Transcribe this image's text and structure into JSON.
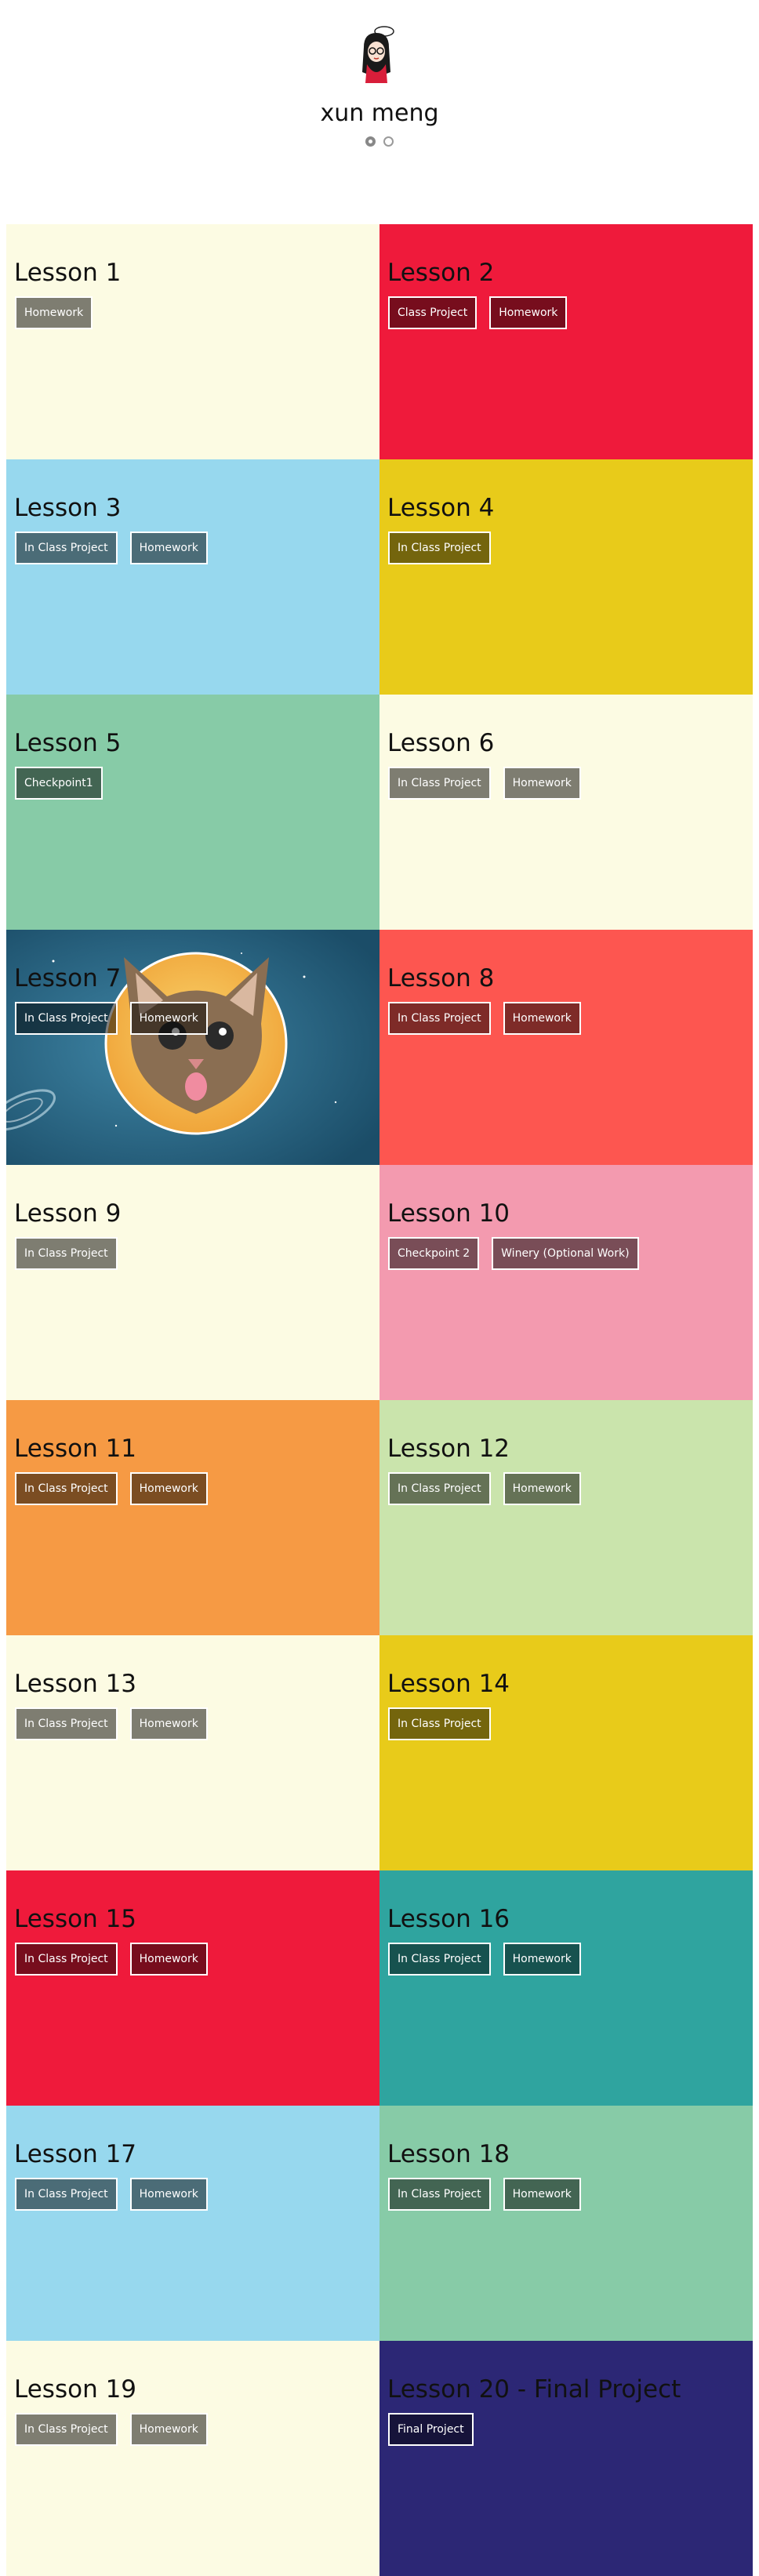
{
  "header": {
    "title": "xun meng",
    "avatar_icon": "cartoon-girl-avatar-icon",
    "social_icons": [
      "github-icon",
      "dribbble-icon"
    ]
  },
  "lessons": [
    {
      "title": "Lesson 1",
      "color": "#fcfbe3",
      "buttons": [
        "Homework"
      ]
    },
    {
      "title": "Lesson 2",
      "color": "#ef1a3b",
      "buttons": [
        "Class Project",
        "Homework"
      ]
    },
    {
      "title": "Lesson 3",
      "color": "#97d8ee",
      "buttons": [
        "In Class Project",
        "Homework"
      ]
    },
    {
      "title": "Lesson 4",
      "color": "#e8cb1a",
      "buttons": [
        "In Class Project"
      ]
    },
    {
      "title": "Lesson 5",
      "color": "#87cba7",
      "buttons": [
        "Checkpoint1"
      ]
    },
    {
      "title": "Lesson 6",
      "color": "#fcfbe3",
      "buttons": [
        "In Class Project",
        "Homework"
      ]
    },
    {
      "title": "Lesson 7",
      "color": "#2f6e8a",
      "buttons": [
        "In Class Project",
        "Homework"
      ],
      "background": "cat-in-space-image"
    },
    {
      "title": "Lesson 8",
      "color": "#fd5650",
      "buttons": [
        "In Class Project",
        "Homework"
      ]
    },
    {
      "title": "Lesson 9",
      "color": "#fcfbe3",
      "buttons": [
        "In Class Project"
      ]
    },
    {
      "title": "Lesson 10",
      "color": "#f39aaf",
      "buttons": [
        "Checkpoint 2",
        "Winery (Optional Work)"
      ]
    },
    {
      "title": "Lesson 11",
      "color": "#f69a44",
      "buttons": [
        "In Class Project",
        "Homework"
      ]
    },
    {
      "title": "Lesson 12",
      "color": "#cae4ac",
      "buttons": [
        "In Class Project",
        "Homework"
      ]
    },
    {
      "title": "Lesson 13",
      "color": "#fcfbe3",
      "buttons": [
        "In Class Project",
        "Homework"
      ]
    },
    {
      "title": "Lesson 14",
      "color": "#e8cb1a",
      "buttons": [
        "In Class Project"
      ]
    },
    {
      "title": "Lesson 15",
      "color": "#ef1a3b",
      "buttons": [
        "In Class Project",
        "Homework"
      ]
    },
    {
      "title": "Lesson 16",
      "color": "#2fa49f",
      "buttons": [
        "In Class Project",
        "Homework"
      ]
    },
    {
      "title": "Lesson 17",
      "color": "#97d8ee",
      "buttons": [
        "In Class Project",
        "Homework"
      ]
    },
    {
      "title": "Lesson 18",
      "color": "#87cba7",
      "buttons": [
        "In Class Project",
        "Homework"
      ]
    },
    {
      "title": "Lesson 19",
      "color": "#fcfbe3",
      "buttons": [
        "In Class Project",
        "Homework"
      ]
    },
    {
      "title": "Lesson 20 - Final Project",
      "color": "#2c2775",
      "buttons": [
        "Final Project"
      ]
    }
  ]
}
